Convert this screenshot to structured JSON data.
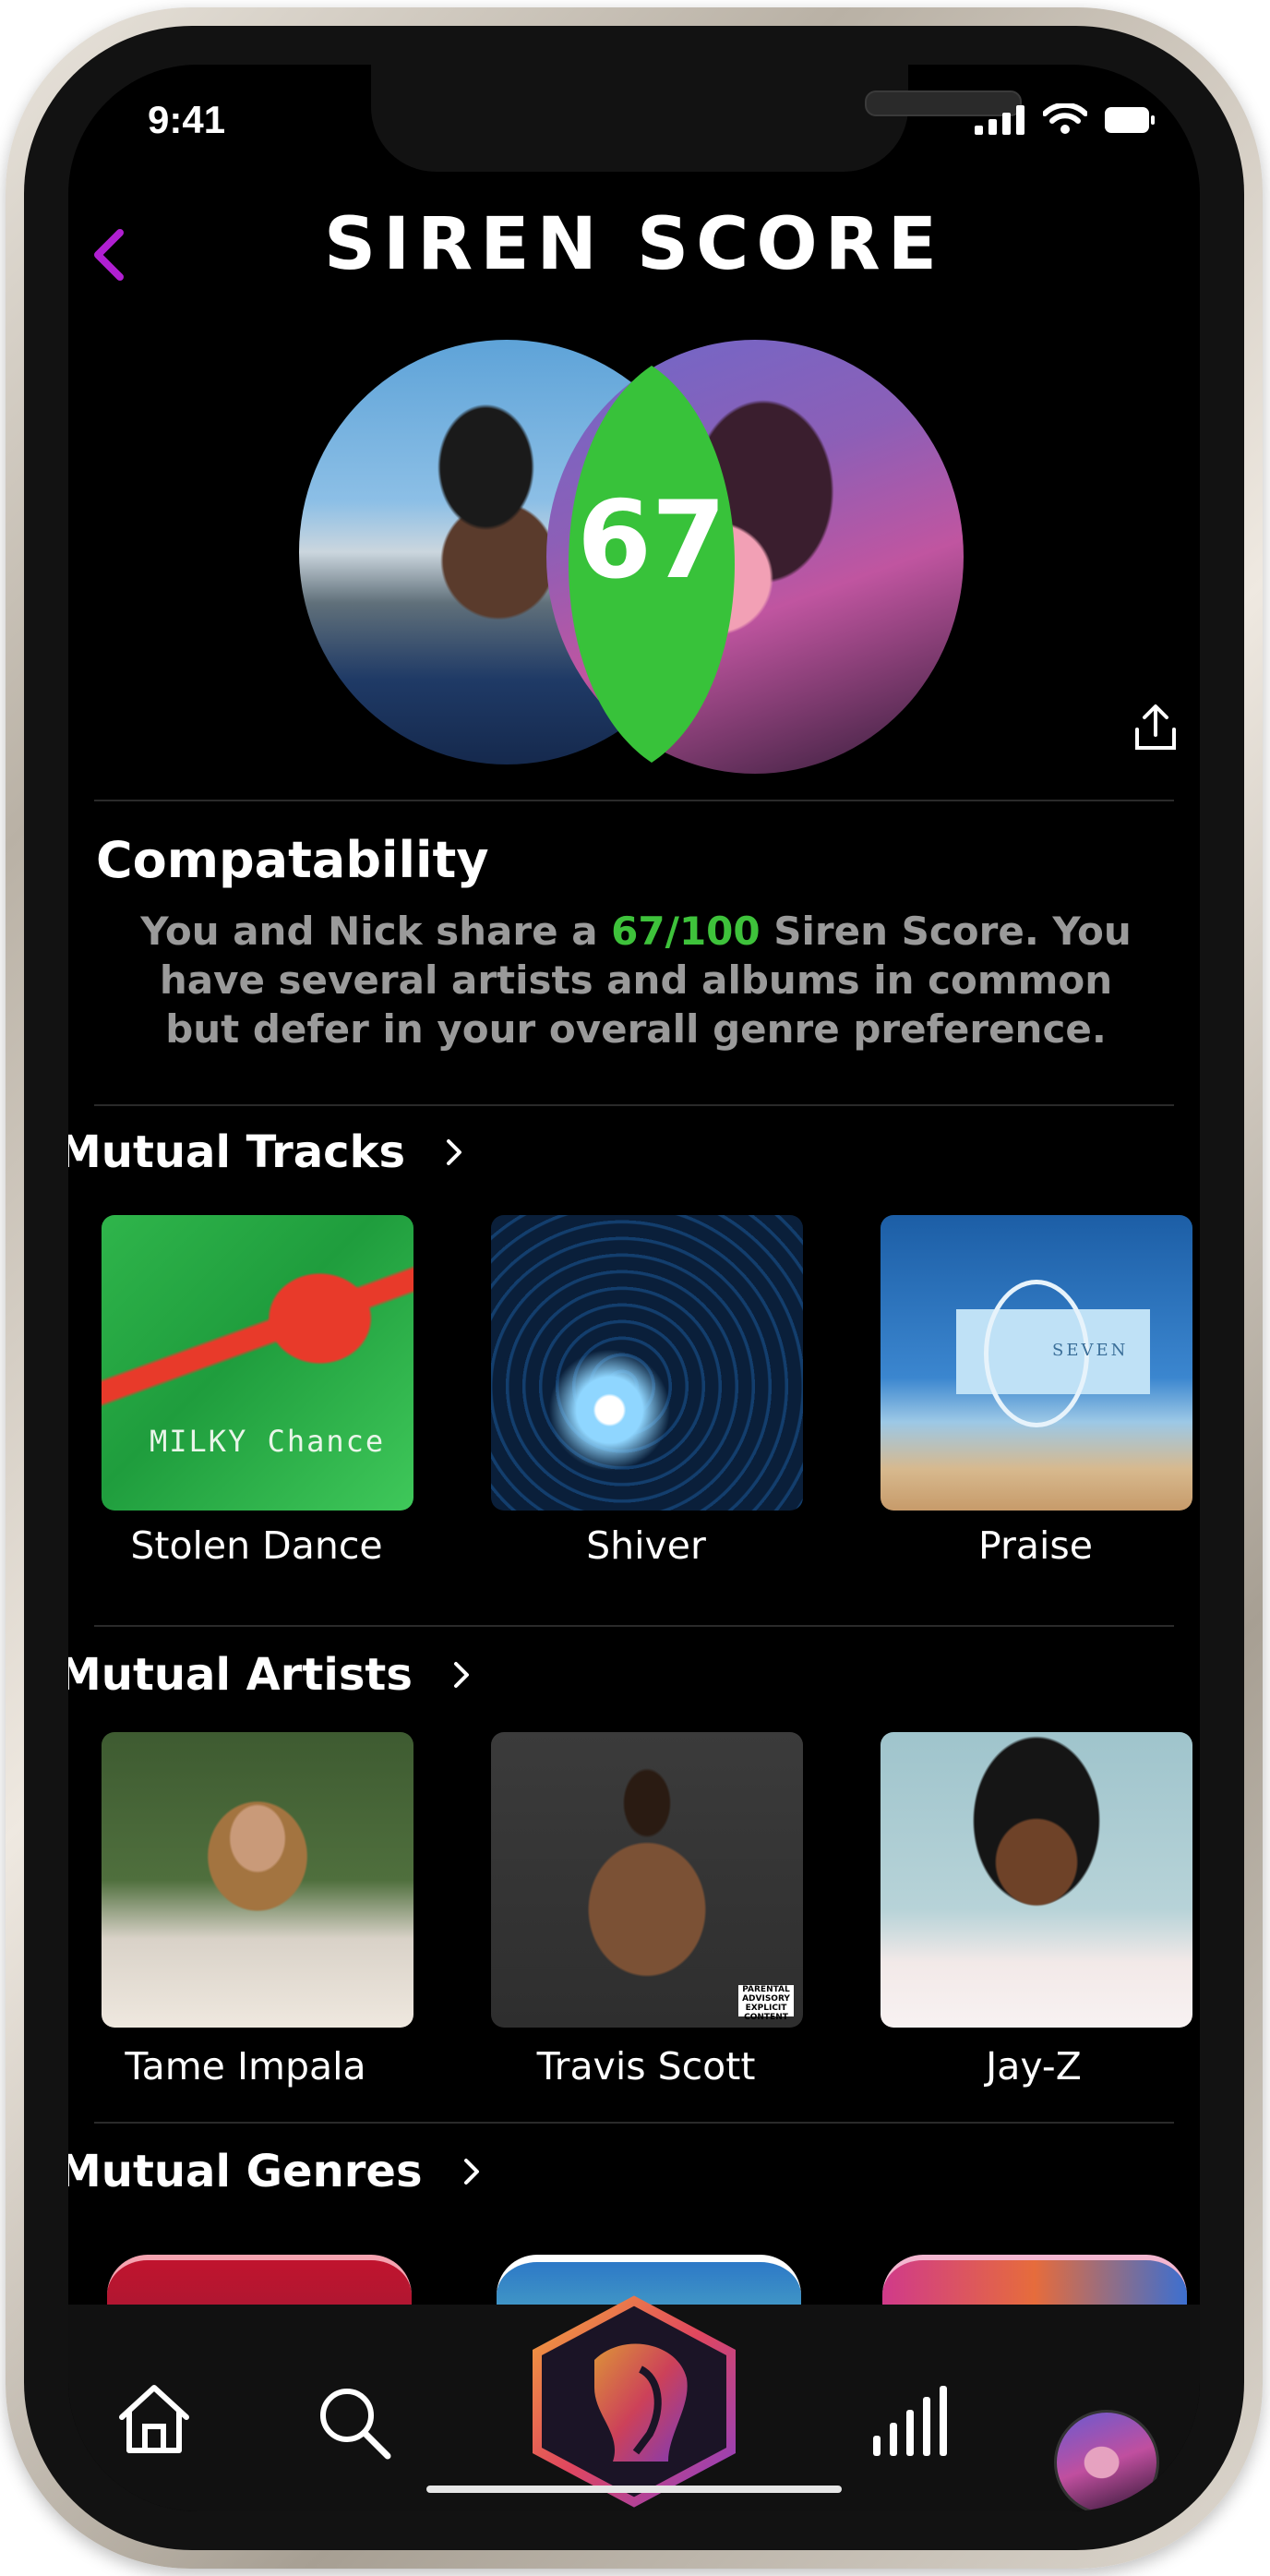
{
  "status_bar": {
    "time": "9:41"
  },
  "header": {
    "title": "SIREN SCORE"
  },
  "score": {
    "value": "67",
    "accent": "#3ec23b"
  },
  "compatibility": {
    "heading": "Compatability",
    "text_before": "You and Nick share a ",
    "highlight": "67/100",
    "text_after": " Siren Score. You have several artists and albums in common but defer in your overall genre preference."
  },
  "mutual_tracks": {
    "title": "Mutual Tracks",
    "items": [
      {
        "label": "Stolen Dance",
        "art_text": "MILKY Chance"
      },
      {
        "label": "Shiver"
      },
      {
        "label": "Praise",
        "art_text": "SEVEN"
      }
    ]
  },
  "mutual_artists": {
    "title": "Mutual Artists",
    "items": [
      {
        "label": "Tame Impala"
      },
      {
        "label": "Travis Scott",
        "badge": "PARENTAL ADVISORY EXPLICIT CONTENT"
      },
      {
        "label": "Jay-Z"
      }
    ]
  },
  "mutual_genres": {
    "title": "Mutual Genres"
  },
  "tab_bar": {
    "items": [
      "home-icon",
      "search-icon",
      "siren-logo-icon",
      "stats-icon",
      "profile-avatar"
    ]
  }
}
